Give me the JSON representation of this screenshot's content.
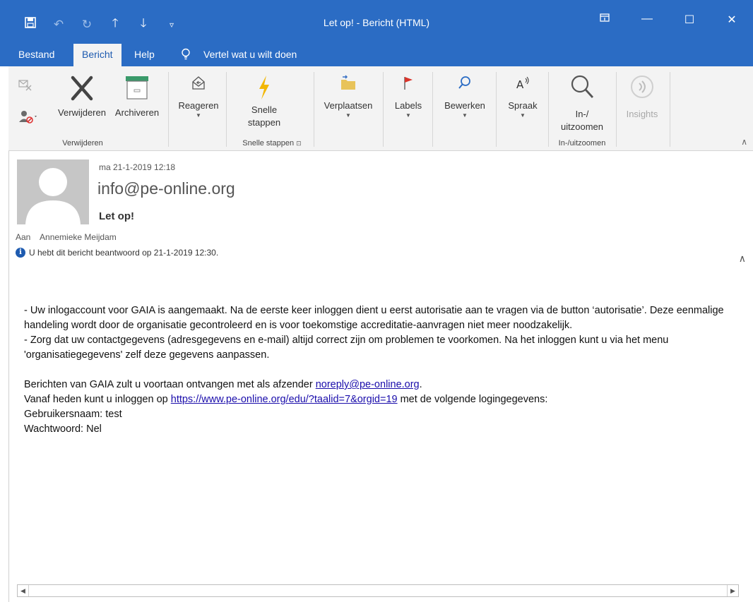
{
  "window": {
    "title": "Let op!  -  Bericht (HTML)",
    "controls": {
      "ribbon_display": "ribbon-display-icon",
      "minimize": "—",
      "maximize": "☐",
      "close": "✕"
    }
  },
  "quick_access": {
    "save": "save-icon",
    "undo": "undo-icon",
    "redo": "redo-icon",
    "up": "up-arrow-icon",
    "down": "down-arrow-icon",
    "customize": "customize-icon"
  },
  "tabs": [
    {
      "label": "Bestand"
    },
    {
      "label": "Bericht"
    },
    {
      "label": "Help"
    }
  ],
  "tell_me": "Vertel wat u wilt doen",
  "ribbon": {
    "verwijderen": {
      "delete": "Verwijderen",
      "archive": "Archiveren",
      "group": "Verwijderen"
    },
    "reply": "Reageren",
    "quick_steps": {
      "line1": "Snelle",
      "line2": "stappen",
      "group": "Snelle stappen"
    },
    "move": "Verplaatsen",
    "labels": "Labels",
    "edit": "Bewerken",
    "speech": "Spraak",
    "zoom": {
      "line1": "In-/",
      "line2": "uitzoomen",
      "group": "In-/uitzoomen"
    },
    "insights": "Insights"
  },
  "message": {
    "date": "ma 21-1-2019 12:18",
    "from": "info@pe-online.org",
    "subject": "Let op!",
    "to_label": "Aan",
    "to": "Annemieke Meijdam",
    "notice": "U hebt dit bericht beantwoord op 21-1-2019 12:30.",
    "body": {
      "p1": "- Uw inlogaccount voor GAIA is aangemaakt. Na de eerste keer inloggen dient u eerst autorisatie aan te vragen via de button ‘autorisatie’. Deze eenmalige handeling wordt door de organisatie gecontroleerd en is voor toekomstige accreditatie-aanvragen niet meer noodzakelijk.",
      "p2": "- Zorg dat uw contactgegevens (adresgegevens en e-mail) altijd correct zijn om problemen te voorkomen. Na het inloggen kunt u via het menu 'organisatiegegevens' zelf deze gegevens aanpassen.",
      "p3_before": "Berichten van GAIA zult u voortaan ontvangen met als afzender ",
      "p3_link": "noreply@pe-online.org",
      "p3_after": ".",
      "p4_before": "Vanaf heden kunt u inloggen op ",
      "p4_link": "https://www.pe-online.org/edu/?taalid=7&orgid=19",
      "p4_after": " met de volgende logingegevens:",
      "user": "Gebruikersnaam: test",
      "password": "Wachtwoord: Nel"
    }
  }
}
